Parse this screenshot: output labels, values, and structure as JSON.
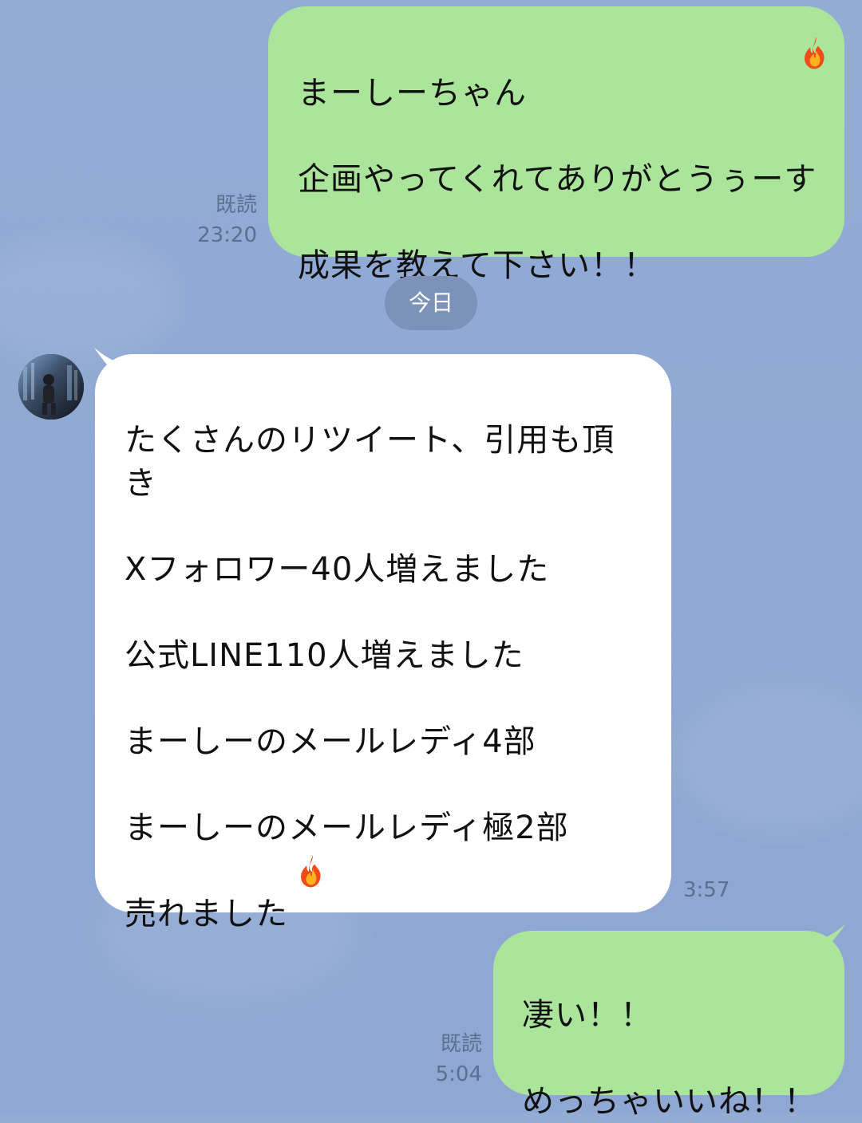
{
  "chat": {
    "messages": [
      {
        "id": "m1",
        "direction": "out",
        "text": "まーしーちゃん\n\n企画やってくれてありがとうぅーす\n\n成果を教えて下さい！！",
        "read_label": "既読",
        "time": "23:20",
        "emoji_after_first_line": "fire"
      },
      {
        "id": "m2",
        "direction": "in",
        "text": "たくさんのリツイート、引用も頂\nき\n\nXフォロワー40人増えました\n\n公式LINE110人増えました\n\nまーしーのメールレディ4部\n\nまーしーのメールレディ極2部\n\n売れました",
        "time": "3:57",
        "emoji_after_last_line": "fire"
      },
      {
        "id": "m3",
        "direction": "out",
        "text": "凄い！！\n\nめっちゃいいね！！",
        "read_label": "既読",
        "time": "5:04"
      }
    ],
    "date_separator": "今日",
    "colors": {
      "background": "#93acd6",
      "outgoing_bubble": "#abe49b",
      "incoming_bubble": "#ffffff",
      "date_pill": "#7c92b8",
      "meta_text": "#5d6f8f"
    }
  }
}
